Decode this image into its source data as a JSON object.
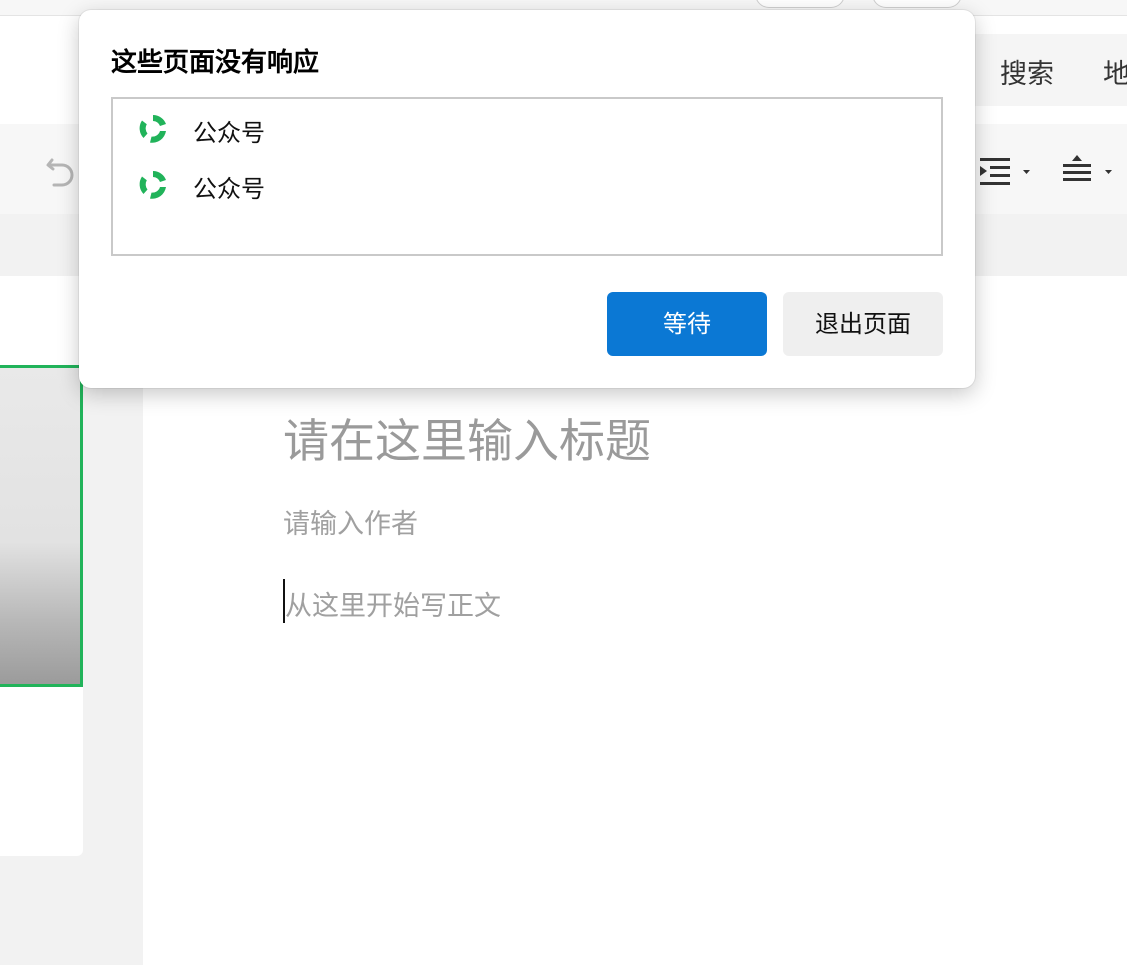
{
  "header": {
    "search_label": "搜索",
    "map_label": "地"
  },
  "editor": {
    "title_placeholder": "请在这里输入标题",
    "author_placeholder": "请输入作者",
    "body_placeholder": "从这里开始写正文"
  },
  "dialog": {
    "title": "这些页面没有响应",
    "pages": [
      {
        "name": "公众号",
        "icon": "wechat-official-icon"
      },
      {
        "name": "公众号",
        "icon": "wechat-official-icon"
      }
    ],
    "wait_label": "等待",
    "exit_label": "退出页面"
  },
  "colors": {
    "accent_button": "#0b78d4",
    "cover_border": "#21b35a",
    "icon_green": "#21b35a"
  }
}
